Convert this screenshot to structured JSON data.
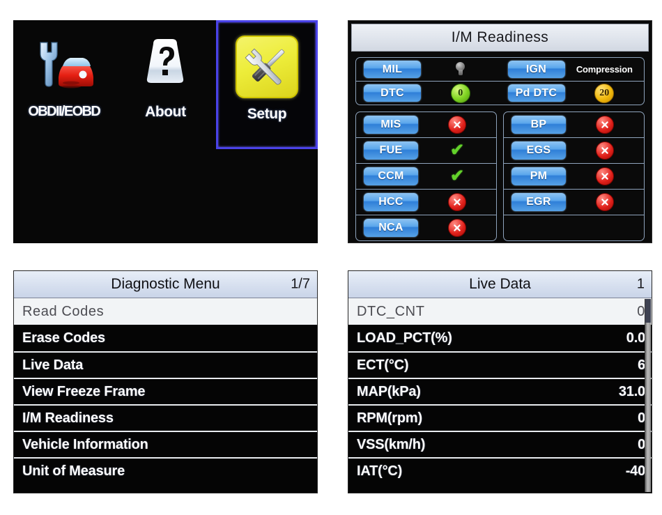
{
  "main_menu": {
    "tiles": [
      {
        "label": "OBDII/EOBD",
        "icon": "wrench-car-icon",
        "selected": false
      },
      {
        "label": "About",
        "icon": "question-mark-icon",
        "selected": false
      },
      {
        "label": "Setup",
        "icon": "wrench-screwdriver-icon",
        "selected": true
      }
    ],
    "selection_border_color": "#4a42e8",
    "setup_tile_color": "#eded3a"
  },
  "im_readiness": {
    "title": "I/M Readiness",
    "status_rows": [
      {
        "left_label": "MIL",
        "left_value": "",
        "left_icon": "lightbulb-icon",
        "right_label": "IGN",
        "right_value": "Compression",
        "right_icon": "text"
      },
      {
        "left_label": "DTC",
        "left_value": "0",
        "left_icon": "green-badge",
        "right_label": "Pd DTC",
        "right_value": "20",
        "right_icon": "amber-badge"
      }
    ],
    "monitors_left": [
      {
        "label": "MIS",
        "status": "fail"
      },
      {
        "label": "FUE",
        "status": "pass"
      },
      {
        "label": "CCM",
        "status": "pass"
      },
      {
        "label": "HCC",
        "status": "fail"
      },
      {
        "label": "NCA",
        "status": "fail"
      }
    ],
    "monitors_right": [
      {
        "label": "BP",
        "status": "fail"
      },
      {
        "label": "EGS",
        "status": "fail"
      },
      {
        "label": "PM",
        "status": "fail"
      },
      {
        "label": "EGR",
        "status": "fail"
      },
      {
        "label": "",
        "status": "none"
      }
    ],
    "colors": {
      "pass": "#63d22a",
      "fail": "#e0201a",
      "button": "#2f7fd8"
    }
  },
  "diagnostic_menu": {
    "title": "Diagnostic Menu",
    "counter": "1/7",
    "items": [
      {
        "label": "Read Codes",
        "selected": true
      },
      {
        "label": "Erase Codes",
        "selected": false
      },
      {
        "label": "Live Data",
        "selected": false
      },
      {
        "label": "View Freeze Frame",
        "selected": false
      },
      {
        "label": "I/M Readiness",
        "selected": false
      },
      {
        "label": "Vehicle Information",
        "selected": false
      },
      {
        "label": "Unit of Measure",
        "selected": false
      }
    ]
  },
  "live_data": {
    "title": "Live Data",
    "counter": "1",
    "rows": [
      {
        "name": "DTC_CNT",
        "value": "0",
        "selected": true
      },
      {
        "name": "LOAD_PCT(%)",
        "value": "0.0",
        "selected": false
      },
      {
        "name": "ECT(°C)",
        "value": "6",
        "selected": false
      },
      {
        "name": "MAP(kPa)",
        "value": "31.0",
        "selected": false
      },
      {
        "name": "RPM(rpm)",
        "value": "0",
        "selected": false
      },
      {
        "name": "VSS(km/h)",
        "value": "0",
        "selected": false
      },
      {
        "name": "IAT(°C)",
        "value": "-40",
        "selected": false
      }
    ]
  }
}
